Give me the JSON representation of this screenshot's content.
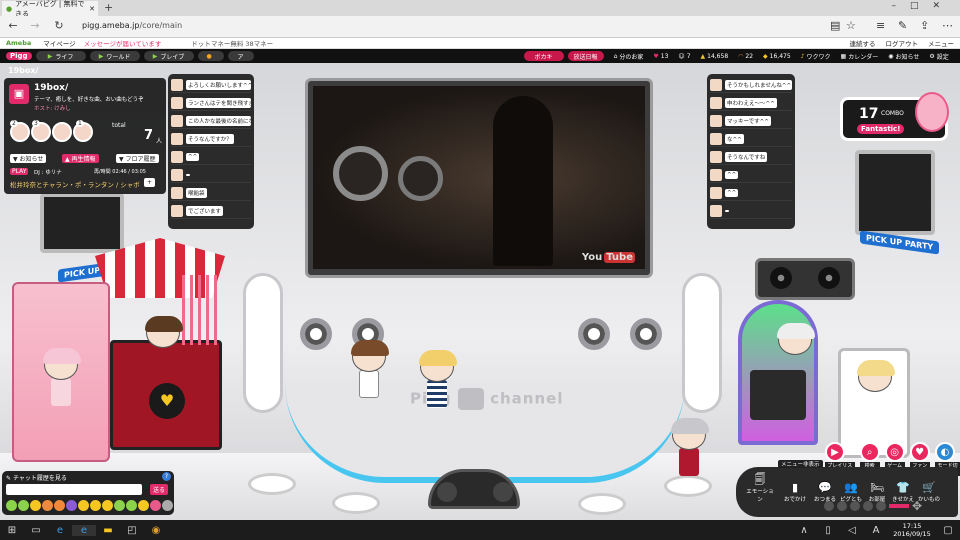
{
  "browser": {
    "tab_title": "アメーバピグ | 無料できる",
    "new_tab": "+",
    "url_domain": "pigg.ameba.jp",
    "url_path": "/core/main"
  },
  "ameba_bar": {
    "logo": "Ameba",
    "mypage": "マイページ",
    "message_notice": "メッセージが届いています",
    "ads": "ドットマネー無料 38マネー",
    "right_links": [
      "連続する",
      "ログアウト",
      "メニュー"
    ]
  },
  "pigg_bar": {
    "logo": "Pigg",
    "tabs": [
      "ライフ",
      "ワールド",
      "ブレイブ",
      "",
      "ア"
    ],
    "buttons": [
      "ボカキ",
      "放送日報"
    ],
    "room_label": "分のお家",
    "stats": [
      "13",
      "7",
      "14,658",
      "22",
      "16,475"
    ],
    "wakuwaku": "ワクワク",
    "calendar": "カレンダー",
    "notice": "お知らせ",
    "settings": "設定"
  },
  "room": {
    "title": "19box/",
    "name": "19box/",
    "theme": "テーマ、癒しを、好きな曲、おい曲もどうぞ",
    "owner": "ホスト: けみし",
    "total_label": "total",
    "total_count": "7",
    "total_unit": "人",
    "ranks": [
      "2",
      "3",
      "",
      "1"
    ],
    "btn_notice": "▼ お知らせ",
    "btn_playing": "▲ 再生情報",
    "btn_floor": "▼ フロア履歴",
    "play_badge": "PLAY",
    "dj_label": "DJ : ゆリナ",
    "play_time": "再/時間 02:46 / 03:05",
    "song": "松井玲奈とチャラン・ポ・ランタン / シャボ",
    "plus": "+"
  },
  "chat_left": [
    "よろしくお願いします^^",
    "ランさんはテを聞き飛すますか？",
    "この人かな最後の名前になったのは",
    "そうなんですか？",
    "^^",
    "",
    "喉飴袋",
    "でございます",
    "ニュースで見たような"
  ],
  "chat_right": [
    "そうかもしれませんね^^",
    "申わわええ〜〜^^",
    "マッキーです^^",
    "な^^",
    "そうなんですね",
    "^^",
    "^^",
    "",
    "あい^^"
  ],
  "video": {
    "brand_you": "You",
    "brand_tube": "Tube"
  },
  "channel": {
    "pigg": "Pigg",
    "channel": "channel",
    "pickup_left": "PICK UP PARTY",
    "pickup_right": "PICK UP PARTY"
  },
  "combo": {
    "count": "17",
    "label": "COMBO",
    "praise": "Fantastic!"
  },
  "chat_input": {
    "history_label": "チャット履歴を見る",
    "send": "送る"
  },
  "controls": {
    "menu_label": "メニュー非表示",
    "top_buttons": [
      "プレイリスト",
      "検索",
      "ゲーム",
      "ファン数",
      "モード切替"
    ],
    "items": [
      {
        "icon": "🗐",
        "label": "エモーション"
      },
      {
        "icon": "▮",
        "label": "おでかけ"
      },
      {
        "icon": "💬",
        "label": "おつまる"
      },
      {
        "icon": "👥",
        "label": "ピグとも"
      },
      {
        "icon": "🛏",
        "label": "お部屋"
      },
      {
        "icon": "👕",
        "label": "きせかえ"
      },
      {
        "icon": "🛒",
        "label": "かいもの"
      }
    ]
  },
  "taskbar": {
    "time": "17:15",
    "date": "2016/09/15"
  }
}
